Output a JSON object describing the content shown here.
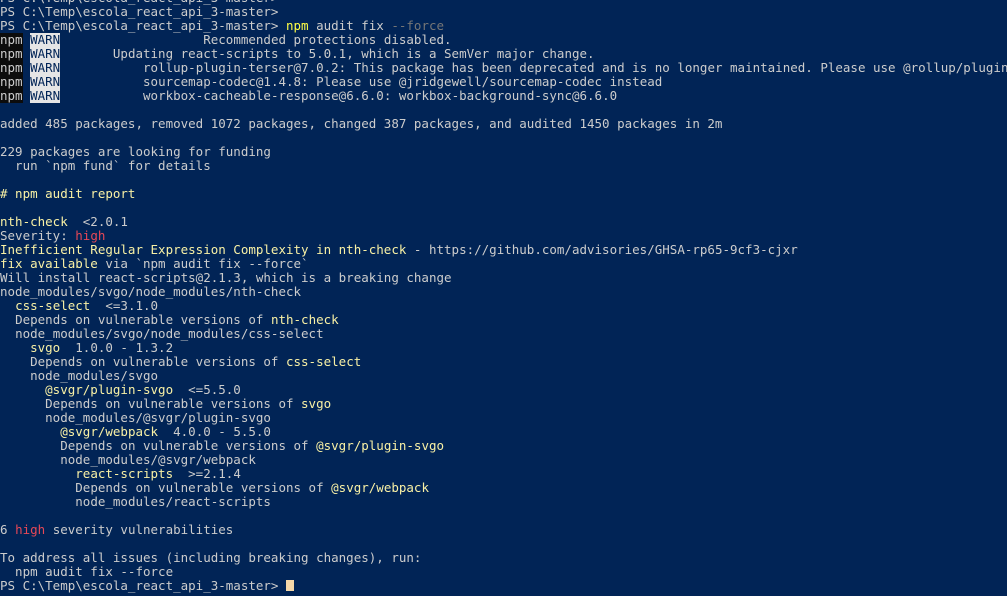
{
  "window": {
    "app": "Windows PowerShell",
    "background_color": "#012456",
    "foreground_color": "#cccccc",
    "font": "monospace",
    "columns": 118,
    "rows": 43
  },
  "palette": {
    "white": "#cccccc",
    "bright_white": "#f2f2f2",
    "yellow": "#f9f1a5",
    "bright_yellow": "#ffff45",
    "red": "#e74856",
    "gray": "#767676",
    "tag_npm_bg": "#0c0c0c",
    "tag_warn_bg": "#e5e5e5",
    "cursor": "#f5d7a8"
  },
  "prompt": {
    "text": "PS C:\\Temp\\escola_react_api_3-master>",
    "path": "C:\\Temp\\escola_react_api_3-master"
  },
  "command": {
    "program": "npm",
    "args": "audit fix",
    "flag": "--force",
    "full": "npm audit fix --force"
  },
  "warnings": [
    {
      "tag1": "npm",
      "tag2": "WARN",
      "indent": 18,
      "text": "Recommended protections disabled."
    },
    {
      "tag1": "npm",
      "tag2": "WARN",
      "indent": 6,
      "text": "Updating react-scripts to 5.0.1, which is a SemVer major change."
    },
    {
      "tag1": "npm",
      "tag2": "WARN",
      "indent": 10,
      "text": "rollup-plugin-terser@7.0.2: This package has been deprecated and is no longer maintained. Please use @rollup/plugin-terser"
    },
    {
      "tag1": "npm",
      "tag2": "WARN",
      "indent": 10,
      "text": "sourcemap-codec@1.4.8: Please use @jridgewell/sourcemap-codec instead"
    },
    {
      "tag1": "npm",
      "tag2": "WARN",
      "indent": 10,
      "text": "workbox-cacheable-response@6.6.0: workbox-background-sync@6.6.0"
    }
  ],
  "summary": {
    "install_line": "added 485 packages, removed 1072 packages, changed 387 packages, and audited 1450 packages in 2m",
    "added": 485,
    "removed": 1072,
    "changed": 387,
    "audited": 1450,
    "duration": "2m",
    "funding_line": "229 packages are looking for funding",
    "funding_count": 229,
    "funding_details": "  run `npm fund` for details"
  },
  "report": {
    "heading": "# npm audit report",
    "advisory": {
      "package": "nth-check",
      "range": "  <2.0.1",
      "severity_label": "Severity: ",
      "severity": "high",
      "title": "Inefficient Regular Expression Complexity in nth-check",
      "url_sep": " - ",
      "url": "https://github.com/advisories/GHSA-rp65-9cf3-cjxr",
      "fix_label": "fix available",
      "fix_rest": " via `npm audit fix --force`",
      "breaking": "Will install react-scripts@2.1.3, which is a breaking change",
      "path": "node_modules/svgo/node_modules/nth-check"
    },
    "tree": [
      {
        "indent": 2,
        "type": "pkg",
        "name": "css-select",
        "range": "  <=3.1.0"
      },
      {
        "indent": 2,
        "type": "dep",
        "prefix": "Depends on vulnerable versions of ",
        "name": "nth-check"
      },
      {
        "indent": 2,
        "type": "path",
        "text": "node_modules/svgo/node_modules/css-select"
      },
      {
        "indent": 4,
        "type": "pkg",
        "name": "svgo",
        "range": "  1.0.0 - 1.3.2"
      },
      {
        "indent": 4,
        "type": "dep",
        "prefix": "Depends on vulnerable versions of ",
        "name": "css-select"
      },
      {
        "indent": 4,
        "type": "path",
        "text": "node_modules/svgo"
      },
      {
        "indent": 6,
        "type": "pkg",
        "name": "@svgr/plugin-svgo",
        "range": "  <=5.5.0"
      },
      {
        "indent": 6,
        "type": "dep",
        "prefix": "Depends on vulnerable versions of ",
        "name": "svgo"
      },
      {
        "indent": 6,
        "type": "path",
        "text": "node_modules/@svgr/plugin-svgo"
      },
      {
        "indent": 8,
        "type": "pkg",
        "name": "@svgr/webpack",
        "range": "  4.0.0 - 5.5.0"
      },
      {
        "indent": 8,
        "type": "dep",
        "prefix": "Depends on vulnerable versions of ",
        "name": "@svgr/plugin-svgo"
      },
      {
        "indent": 8,
        "type": "path",
        "text": "node_modules/@svgr/webpack"
      },
      {
        "indent": 10,
        "type": "pkg",
        "name": "react-scripts",
        "range": "  >=2.1.4"
      },
      {
        "indent": 10,
        "type": "dep",
        "prefix": "Depends on vulnerable versions of ",
        "name": "@svgr/webpack"
      },
      {
        "indent": 10,
        "type": "path",
        "text": "node_modules/react-scripts"
      }
    ],
    "totals": {
      "count": "6 ",
      "severity": "high",
      "suffix": " severity vulnerabilities"
    },
    "address_line": "To address all issues (including breaking changes), run:",
    "address_command": "  npm audit fix --force"
  }
}
